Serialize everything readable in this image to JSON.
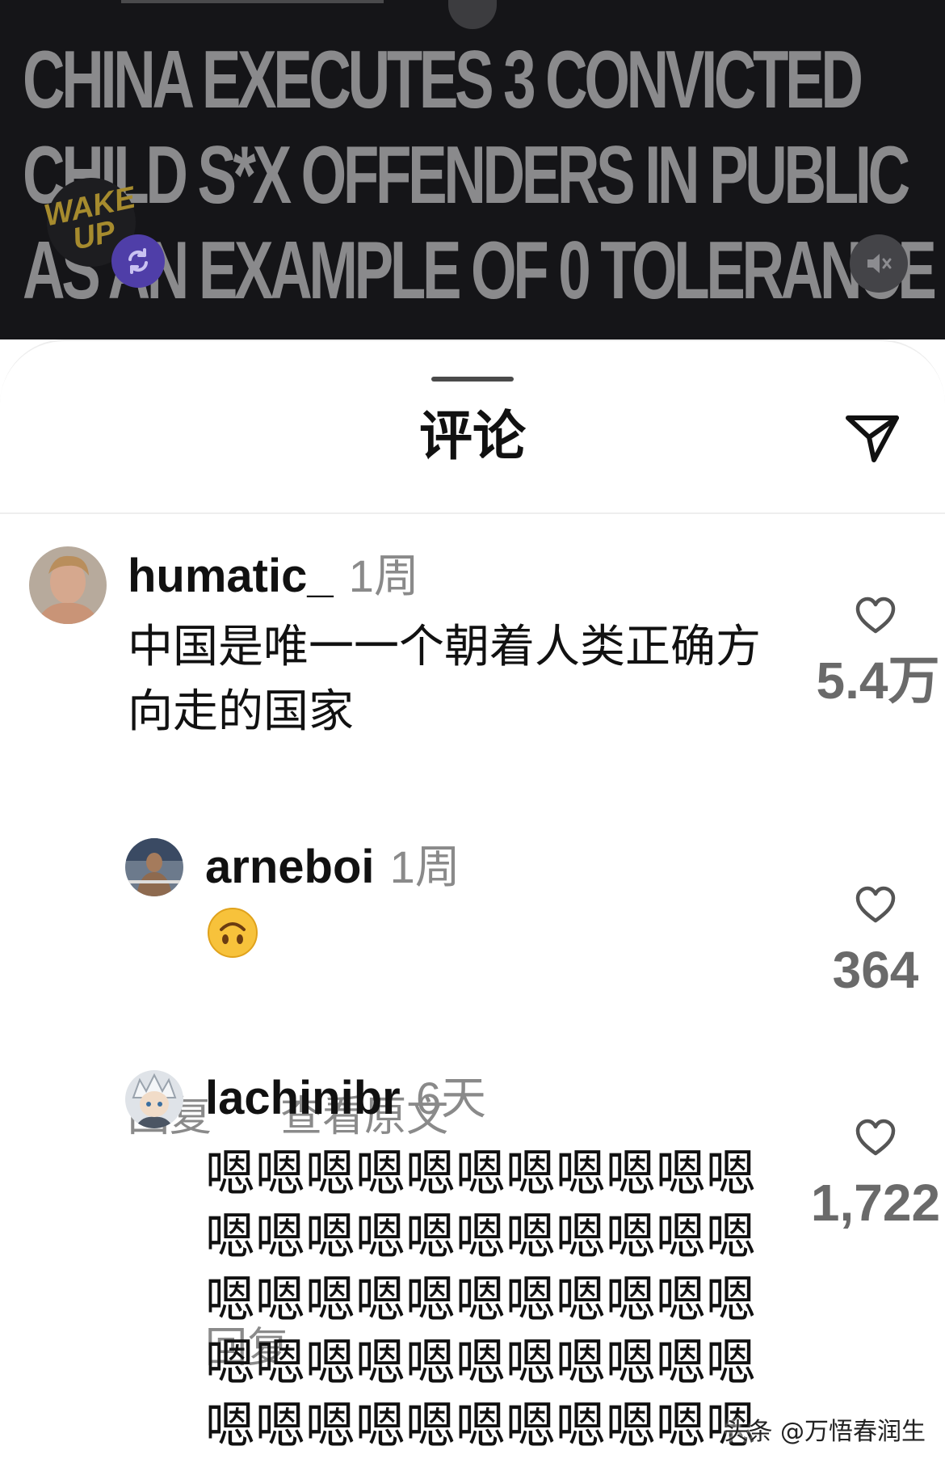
{
  "video": {
    "headline_lines": [
      "CHINA EXECUTES 3 CONVICTED",
      "CHILD S*X OFFENDERS IN PUBLIC",
      "AS AN EXAMPLE OF 0 TOLERANCE"
    ],
    "logo_text": "WAKE UP",
    "icons": {
      "repeat": "repeat-icon",
      "mute": "speaker-muted-icon"
    },
    "colors": {
      "repeat_button": "#4f3ea8",
      "logo": "#a68b2e"
    }
  },
  "sheet": {
    "title": "评论",
    "share_icon": "paper-plane-icon"
  },
  "comments": [
    {
      "username": "humatic_",
      "time": "1周",
      "text": "中国是唯一一个朝着人类正确方向走的国家",
      "reply_label": "回复",
      "translate_label": "查看原文",
      "likes": "5.4万"
    },
    {
      "username": "arneboi",
      "time": "1周",
      "emoji": "upside-down-face-emoji",
      "reply_label": "回复",
      "likes": "364"
    },
    {
      "username": "lachinibr",
      "time": "6天",
      "text": "嗯嗯嗯嗯嗯嗯嗯嗯嗯嗯嗯嗯嗯嗯嗯嗯嗯嗯嗯嗯嗯嗯嗯嗯嗯嗯嗯嗯嗯嗯嗯嗯嗯嗯嗯嗯嗯嗯嗯嗯嗯嗯嗯嗯嗯嗯嗯嗯嗯嗯嗯嗯嗯嗯嗯",
      "likes": "1,722"
    }
  ],
  "watermark": "头条 @万悟春润生"
}
